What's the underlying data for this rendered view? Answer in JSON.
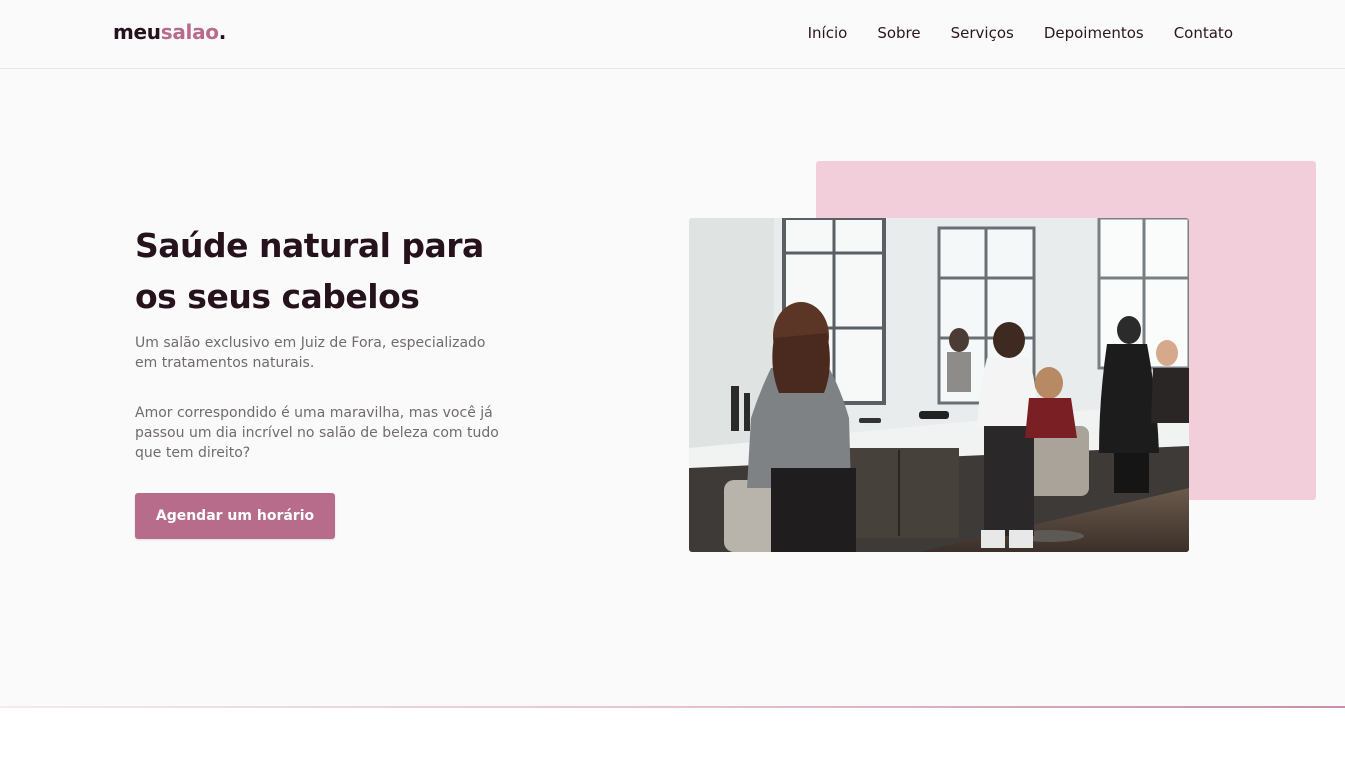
{
  "header": {
    "logo": {
      "main": "meu",
      "accent": "salao",
      "dot": "."
    },
    "nav": [
      "Início",
      "Sobre",
      "Serviços",
      "Depoimentos",
      "Contato"
    ]
  },
  "hero": {
    "title": "Saúde natural para os seus cabelos",
    "paragraph1": "Um salão exclusivo em Juiz de Fora, especializado em tratamentos naturais.",
    "paragraph2": "Amor correspondido é uma maravilha, mas você já passou um dia incrível no salão de beleza com tudo que tem direito?",
    "cta_label": "Agendar um horário",
    "image_icon": "salon-photo"
  },
  "colors": {
    "accent": "#b86c8b",
    "accent_light": "#f2cedb",
    "text_dark": "#26121c",
    "text_muted": "#716b6f",
    "background": "#fafafa"
  }
}
